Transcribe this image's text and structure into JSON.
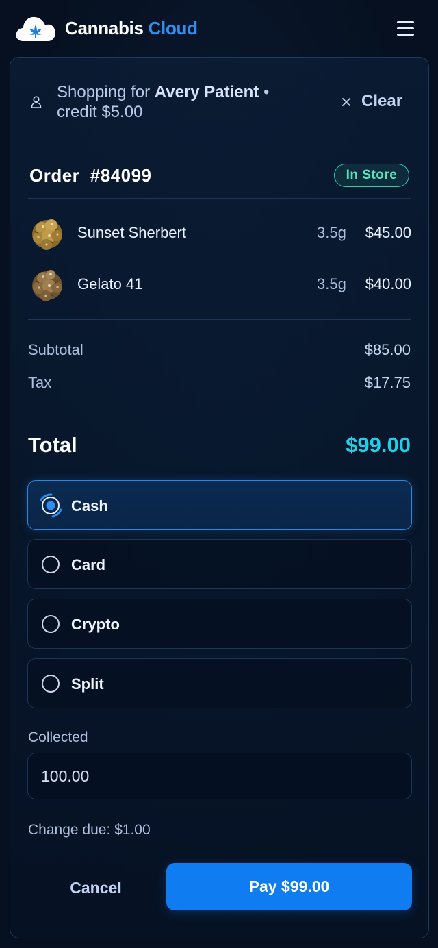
{
  "header": {
    "brand_part1": "Cannabis",
    "brand_part2": "Cloud",
    "logo_icon": "cloud-leaf-logo",
    "menu_icon": "hamburger-menu-icon"
  },
  "customer_bar": {
    "prefix": "Shopping for",
    "customer_name": "Avery Patient",
    "separator": "•",
    "credit_text": "credit $5.00",
    "clear_label": "Clear",
    "user_icon": "user-icon",
    "clear_icon": "close-icon"
  },
  "order": {
    "title": "Order  #84099",
    "status_badge": "In Store"
  },
  "items": [
    {
      "name": "Sunset Sherbert",
      "qty": "3.5g",
      "price": "$45.00",
      "thumb_icon": "cannabis-bud-image"
    },
    {
      "name": "Gelato 41",
      "qty": "3.5g",
      "price": "$40.00",
      "thumb_icon": "cannabis-bud-image"
    }
  ],
  "summary": {
    "subtotal_label": "Subtotal",
    "subtotal_value": "$85.00",
    "tax_label": "Tax",
    "tax_value": "$17.75",
    "total_label": "Total",
    "total_value": "$99.00"
  },
  "payment": {
    "options": [
      {
        "label": "Cash",
        "selected": true
      },
      {
        "label": "Card",
        "selected": false
      },
      {
        "label": "Crypto",
        "selected": false
      },
      {
        "label": "Split",
        "selected": false
      }
    ],
    "collected_label": "Collected",
    "collected_value": "100.00",
    "change_due": "Change due: $1.00"
  },
  "actions": {
    "cancel_label": "Cancel",
    "pay_label": "Pay $99.00"
  },
  "colors": {
    "accent": "#0f7cf2",
    "brand_blue": "#2e8ff0",
    "total_cyan": "#19d3e8",
    "badge_green": "#2fd1a7",
    "background": "#061020"
  }
}
